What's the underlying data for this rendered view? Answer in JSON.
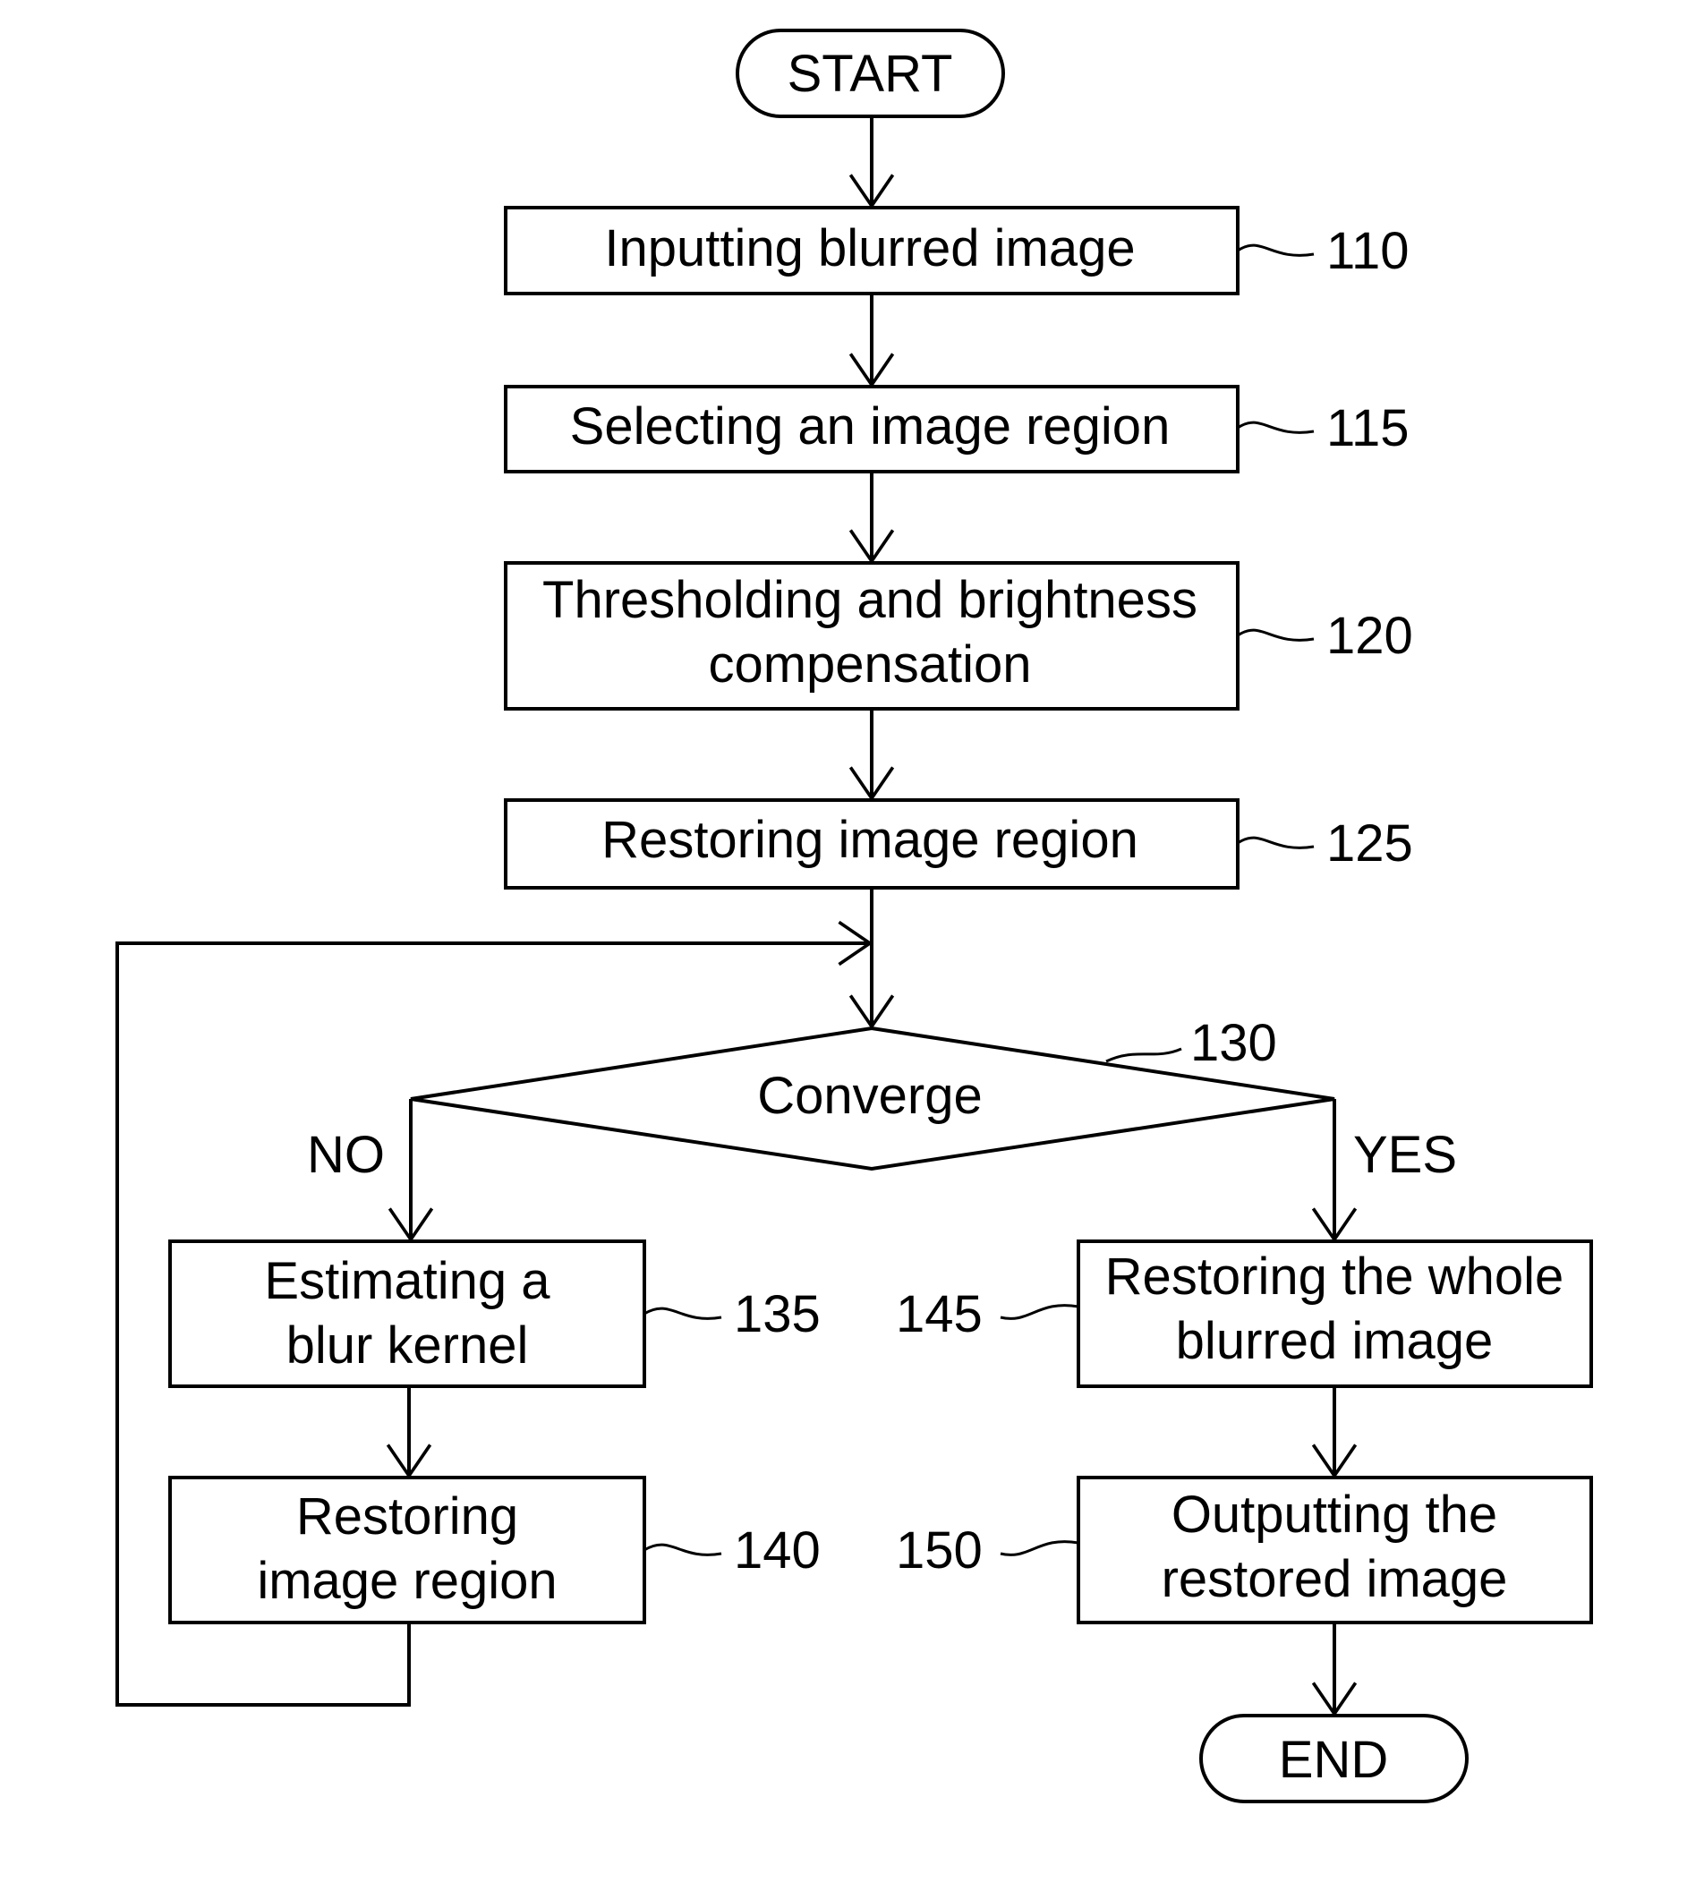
{
  "diagram": {
    "type": "flowchart",
    "start": "START",
    "end": "END",
    "steps": [
      {
        "id": "110",
        "lines": [
          "Inputting blurred image"
        ]
      },
      {
        "id": "115",
        "lines": [
          "Selecting an image region"
        ]
      },
      {
        "id": "120",
        "lines": [
          "Thresholding and brightness",
          "compensation"
        ]
      },
      {
        "id": "125",
        "lines": [
          "Restoring image region"
        ]
      },
      {
        "id": "135",
        "lines": [
          "Estimating a",
          "blur kernel"
        ]
      },
      {
        "id": "140",
        "lines": [
          "Restoring",
          "image region"
        ]
      },
      {
        "id": "145",
        "lines": [
          "Restoring the whole",
          "blurred image"
        ]
      },
      {
        "id": "150",
        "lines": [
          "Outputting the",
          "restored image"
        ]
      }
    ],
    "decision": {
      "id": "130",
      "label": "Converge",
      "no_label": "NO",
      "yes_label": "YES"
    }
  }
}
